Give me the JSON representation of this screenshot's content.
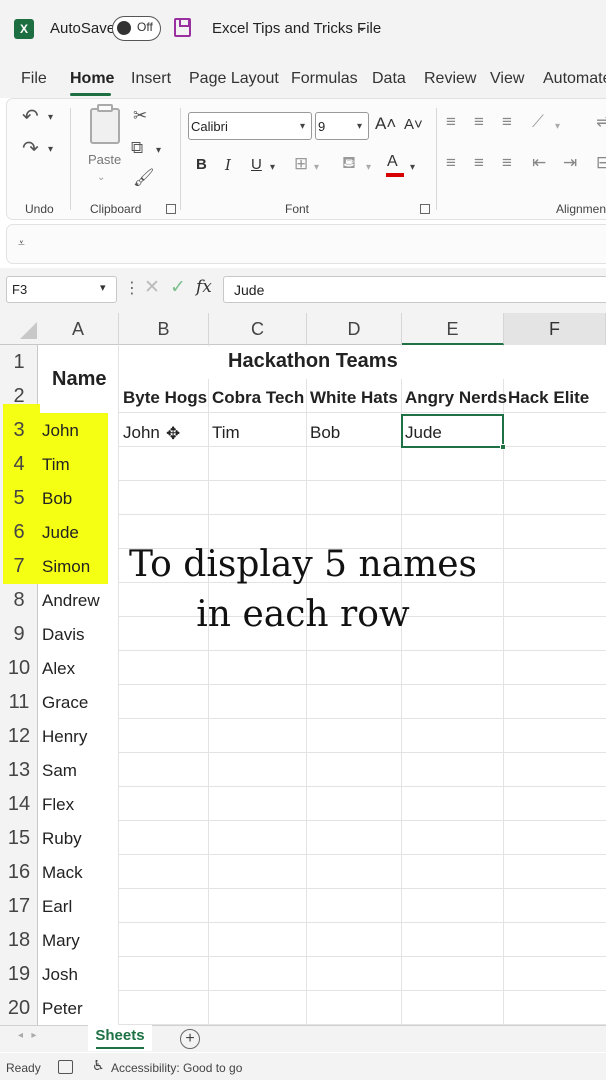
{
  "titlebar": {
    "app_icon_letter": "X",
    "autosave_label": "AutoSave",
    "autosave_state": "Off",
    "file_title": "Excel Tips and Tricks File",
    "title_chevron": "⌄"
  },
  "menu": {
    "tabs": [
      "File",
      "Home",
      "Insert",
      "Page Layout",
      "Formulas",
      "Data",
      "Review",
      "View",
      "Automate"
    ],
    "active": "Home"
  },
  "ribbon": {
    "groups": {
      "undo": "Undo",
      "clipboard": "Clipboard",
      "font": "Font",
      "alignment": "Alignment"
    },
    "paste_label": "Paste",
    "font_name": "Calibri",
    "font_size": "9",
    "font_color": "#d60000",
    "bold": "B",
    "italic": "I",
    "underline": "U",
    "grow_font": "A˄",
    "shrink_font": "A˅",
    "font_color_letter": "A"
  },
  "formula_bar": {
    "cell_ref": "F3",
    "fx": "fx",
    "value": "Jude"
  },
  "grid": {
    "columns": [
      "A",
      "B",
      "C",
      "D",
      "E",
      "F"
    ],
    "rows": [
      "1",
      "2",
      "3",
      "4",
      "5",
      "6",
      "7",
      "8",
      "9",
      "10",
      "11",
      "12",
      "13",
      "14",
      "15",
      "16",
      "17",
      "18",
      "19",
      "20"
    ],
    "header_name": "Name",
    "table_title": "Hackathon Teams",
    "team_headers": [
      "Byte Hogs",
      "Cobra Tech",
      "White Hats",
      "Angry Nerds",
      "Hack Elite"
    ],
    "row3_values": [
      "John",
      "Tim",
      "Bob",
      "Jude",
      ""
    ],
    "names": [
      "John",
      "Tim",
      "Bob",
      "Jude",
      "Simon",
      "Andrew",
      "Davis",
      "Alex",
      "Grace",
      "Henry",
      "Sam",
      "Flex",
      "Ruby",
      "Mack",
      "Earl",
      "Mary",
      "Josh",
      "Peter"
    ],
    "highlighted_rows": 5,
    "highlight_color": "#f5ff14",
    "selected_cell": "E3"
  },
  "caption": {
    "line1": "To display 5 names",
    "line2": "in each row"
  },
  "sheet_tabs": {
    "active": "Sheets",
    "add_symbol": "+"
  },
  "status_bar": {
    "ready": "Ready",
    "accessibility": "Accessibility: Good to go"
  },
  "colors": {
    "excel_green": "#1e7145",
    "save_icon": "#9a2fa0"
  }
}
